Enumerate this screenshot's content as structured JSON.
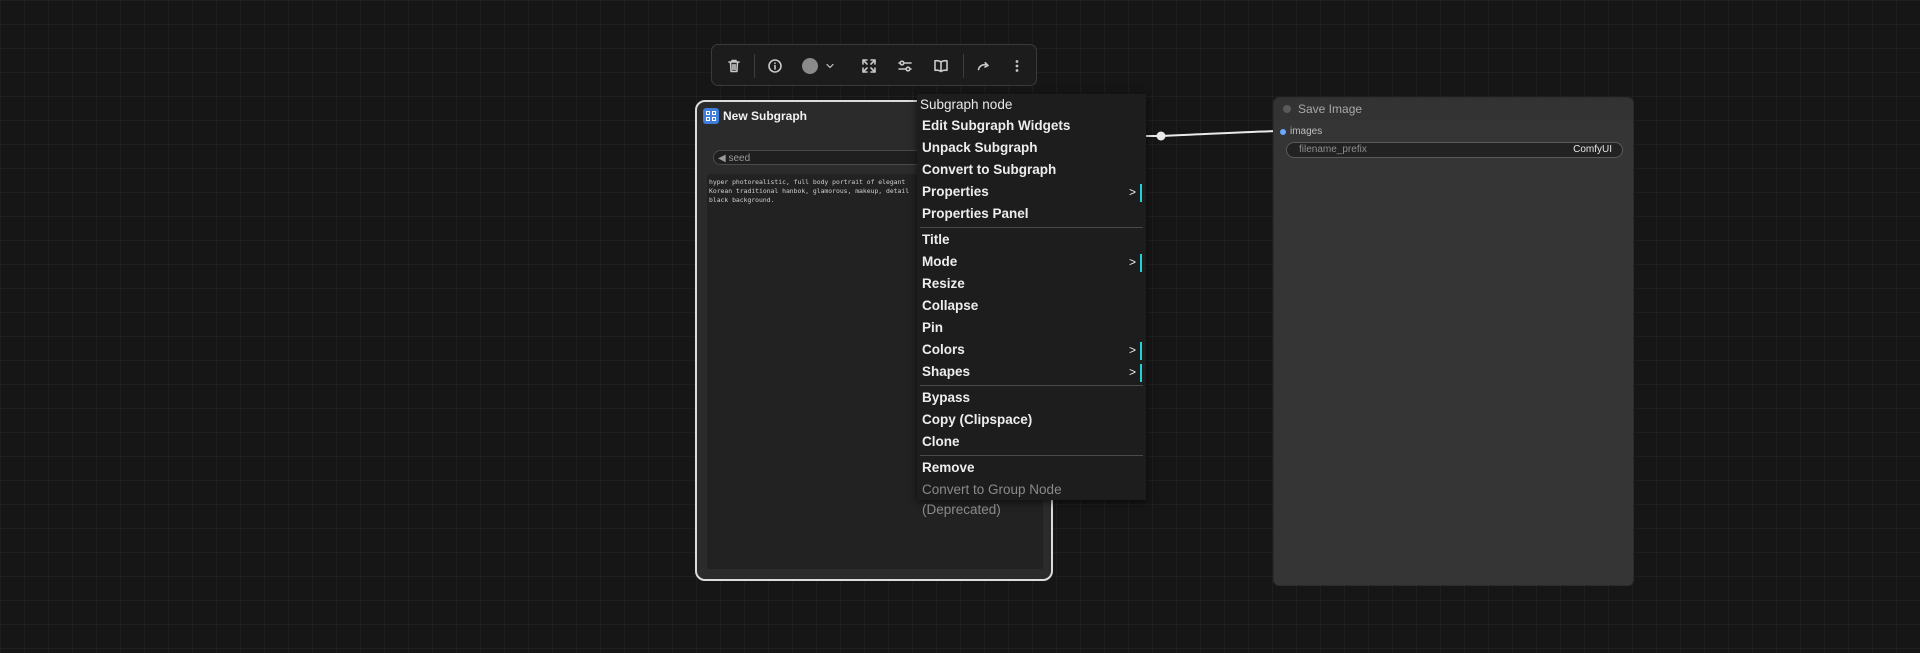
{
  "toolbar": {
    "buttons": [
      "delete-icon",
      "info-icon",
      "color-swatch-icon",
      "fit-view-icon",
      "adjustments-icon",
      "book-icon",
      "redo-icon",
      "more-vertical-icon"
    ],
    "color_swatch": "#8a8a8a"
  },
  "subgraph_node": {
    "title": "New Subgraph",
    "seed_label": "◀ seed",
    "prompt_text": "hyper photorealistic, full body portrait of elegant\nKorean traditional hanbok, glamorous, makeup, detail\nblack background."
  },
  "save_node": {
    "title": "Save Image",
    "input_label": "images",
    "filename_label": "filename_prefix",
    "filename_value": "ComfyUI"
  },
  "context_menu": {
    "title": "Subgraph node",
    "items_group1": [
      {
        "label": "Edit Subgraph Widgets"
      },
      {
        "label": "Unpack Subgraph"
      },
      {
        "label": "Convert to Subgraph"
      },
      {
        "label": "Properties",
        "submenu": ">"
      },
      {
        "label": "Properties Panel"
      }
    ],
    "items_group2": [
      {
        "label": "Title"
      },
      {
        "label": "Mode",
        "submenu": ">"
      },
      {
        "label": "Resize"
      },
      {
        "label": "Collapse"
      },
      {
        "label": "Pin"
      },
      {
        "label": "Colors",
        "submenu": ">"
      },
      {
        "label": "Shapes",
        "submenu": ">"
      }
    ],
    "items_group3": [
      {
        "label": "Bypass"
      },
      {
        "label": "Copy (Clipspace)"
      },
      {
        "label": "Clone"
      }
    ],
    "items_group4": [
      {
        "label": "Remove"
      },
      {
        "label": "Convert to Group Node (Deprecated)"
      }
    ],
    "accent_color": "#22d3d3"
  }
}
